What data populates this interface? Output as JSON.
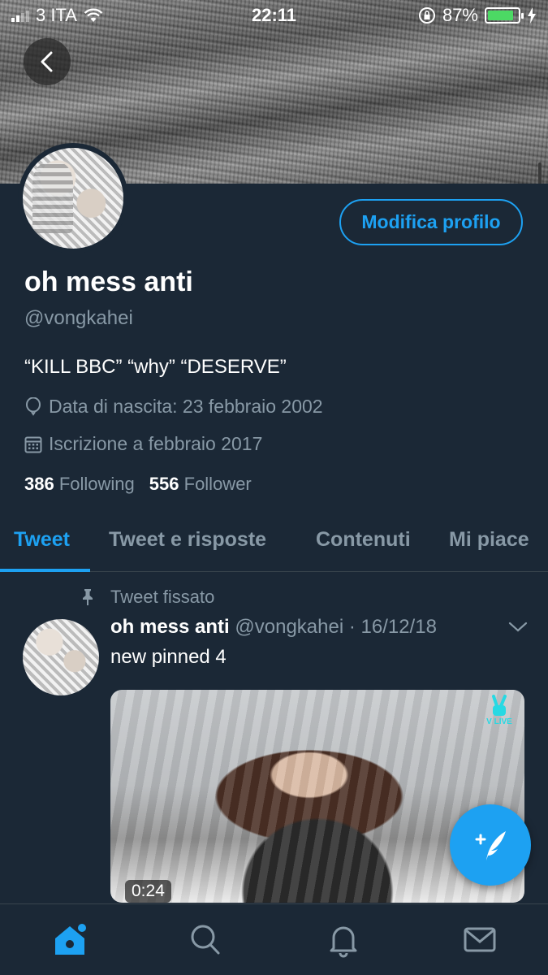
{
  "status_bar": {
    "carrier": "3 ITA",
    "time": "22:11",
    "battery_percent": "87%",
    "battery_level": 0.87
  },
  "profile": {
    "display_name": "oh mess anti",
    "handle": "@vongkahei",
    "bio": "“KILL BBC” “why” “DESERVE”",
    "birthday": "Data di nascita: 23 febbraio 2002",
    "joined": "Iscrizione a febbraio 2017",
    "following_count": "386",
    "following_label": "Following",
    "follower_count": "556",
    "follower_label": "Follower",
    "edit_label": "Modifica profilo"
  },
  "tabs": [
    {
      "label": "Tweet",
      "active": true
    },
    {
      "label": "Tweet e risposte",
      "active": false
    },
    {
      "label": "Contenuti",
      "active": false
    },
    {
      "label": "Mi piace",
      "active": false
    }
  ],
  "tweet": {
    "pinned_label": "Tweet fissato",
    "author_name": "oh mess anti",
    "meta": "@vongkahei · 16/12/18",
    "text": "new pinned 4",
    "media_badge": "V LIVE",
    "duration": "0:24"
  },
  "icons": {
    "back": "chevron-left-icon",
    "pin": "pin-icon",
    "balloon": "balloon-icon",
    "calendar": "calendar-icon",
    "chevron": "chevron-down-icon",
    "compose": "compose-tweet-icon",
    "home": "home-icon",
    "search": "search-icon",
    "notifications": "bell-icon",
    "messages": "mail-icon"
  },
  "colors": {
    "background": "#1b2836",
    "accent": "#1da1f2",
    "muted_text": "#8899a6",
    "divider": "#38444d",
    "battery": "#4cd964"
  }
}
